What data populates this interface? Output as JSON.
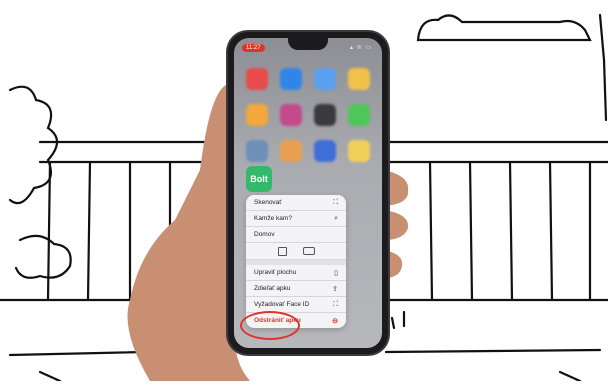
{
  "status_bar": {
    "time": "11:27",
    "icons": "▴ ≋ ▭"
  },
  "home_screen": {
    "blurred_icon_colors": [
      "#e94a4a",
      "#2f86e9",
      "#5aa0f0",
      "#f2c14a",
      "#f2a83a",
      "#c44a8e",
      "#3a3a3e",
      "#4fc65a",
      "#6e8fb8",
      "#e8a050",
      "#3f6ed8",
      "#f0d05a"
    ],
    "app": {
      "name": "Bolt",
      "label": "Bolt"
    }
  },
  "context_menu": {
    "items_top": [
      {
        "label": "Skenovať",
        "icon": "scan-icon",
        "glyph": "⛶"
      },
      {
        "label": "Kamže kam?",
        "icon": "search-icon",
        "glyph": "⌕"
      },
      {
        "label": "Domov",
        "icon": "",
        "glyph": ""
      }
    ],
    "items_bottom": [
      {
        "label": "Upraviť plochu",
        "icon": "phone-icon",
        "glyph": "▯"
      },
      {
        "label": "Zdieľať apku",
        "icon": "share-icon",
        "glyph": "⇪"
      },
      {
        "label": "Vyžadovať Face ID",
        "icon": "faceid-icon",
        "glyph": "⛶"
      }
    ],
    "remove_item": {
      "label": "Odstrániť apku",
      "icon": "remove-icon",
      "glyph": "⊖"
    }
  },
  "colors": {
    "danger": "#e0342a",
    "bolt_green": "#34b86b",
    "menu_bg": "#f4f4f6"
  }
}
